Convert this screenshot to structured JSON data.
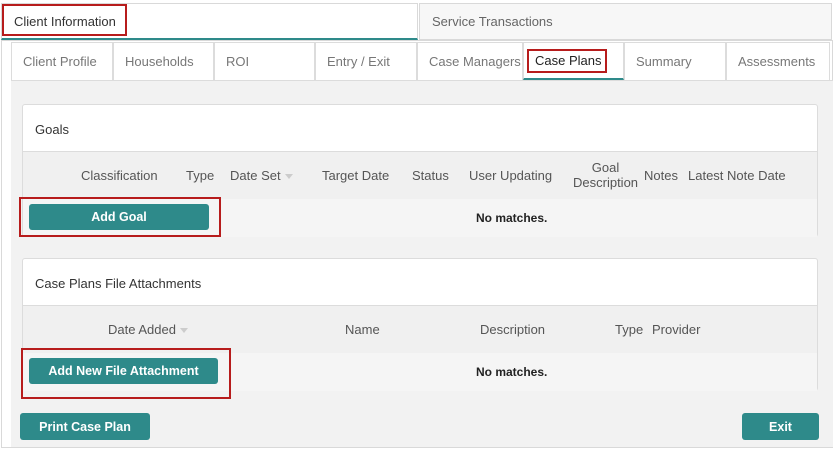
{
  "top_tabs": [
    {
      "label": "Client Information",
      "active": true
    },
    {
      "label": "Service Transactions",
      "active": false
    }
  ],
  "sub_tabs": [
    {
      "label": "Client Profile"
    },
    {
      "label": "Households"
    },
    {
      "label": "ROI"
    },
    {
      "label": "Entry / Exit"
    },
    {
      "label": "Case Managers"
    },
    {
      "label": "Case Plans",
      "active": true
    },
    {
      "label": "Summary"
    },
    {
      "label": "Assessments"
    }
  ],
  "goals": {
    "title": "Goals",
    "columns": {
      "classification": "Classification",
      "type": "Type",
      "date_set": "Date Set",
      "target_date": "Target Date",
      "status": "Status",
      "user_updating": "User Updating",
      "goal_description_1": "Goal",
      "goal_description_2": "Description",
      "notes": "Notes",
      "latest_note_date": "Latest Note Date"
    },
    "add_button": "Add Goal",
    "empty_text": "No matches."
  },
  "attachments": {
    "title": "Case Plans File Attachments",
    "columns": {
      "date_added": "Date Added",
      "name": "Name",
      "description": "Description",
      "type": "Type",
      "provider": "Provider"
    },
    "add_button": "Add New File Attachment",
    "empty_text": "No matches."
  },
  "footer": {
    "print_button": "Print Case Plan",
    "exit_button": "Exit"
  },
  "colors": {
    "accent": "#2e8a8a",
    "highlight_box": "#b71c1c"
  }
}
